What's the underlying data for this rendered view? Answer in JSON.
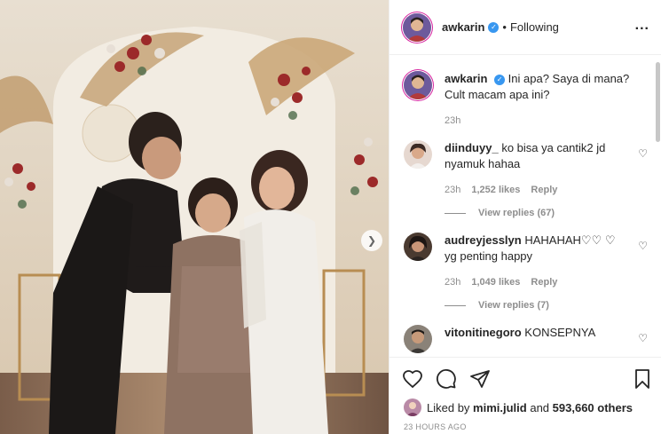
{
  "header": {
    "username": "awkarin",
    "separator": "•",
    "following_label": "Following",
    "more_label": "..."
  },
  "caption": {
    "username": "awkarin",
    "text": "Ini apa? Saya di mana? Cult macam apa ini?",
    "time": "23h"
  },
  "comments": [
    {
      "username": "diinduyy_",
      "text": "ko bisa ya cantik2 jd nyamuk hahaa",
      "time": "23h",
      "likes": "1,252 likes",
      "reply_label": "Reply",
      "view_replies": "View replies (67)"
    },
    {
      "username": "audreyjesslyn",
      "text": "HAHAHAH♡♡ ♡ yg penting happy",
      "time": "23h",
      "likes": "1,049 likes",
      "reply_label": "Reply",
      "view_replies": "View replies (7)"
    },
    {
      "username": "vitonitinegoro",
      "text": "KONSEPNYA"
    }
  ],
  "liked_by": {
    "prefix": "Liked by",
    "user": "mimi.julid",
    "conjunction": "and",
    "others": "593,660 others"
  },
  "timestamp": "23 HOURS AGO",
  "icons": {
    "like": "heart-icon",
    "comment": "comment-icon",
    "share": "share-icon",
    "save": "bookmark-icon",
    "next": "chevron-right-icon",
    "verified": "verified-badge-icon"
  },
  "colors": {
    "verified": "#3897f0",
    "meta_text": "#8e8e8e",
    "text": "#262626",
    "border": "#efefef"
  }
}
